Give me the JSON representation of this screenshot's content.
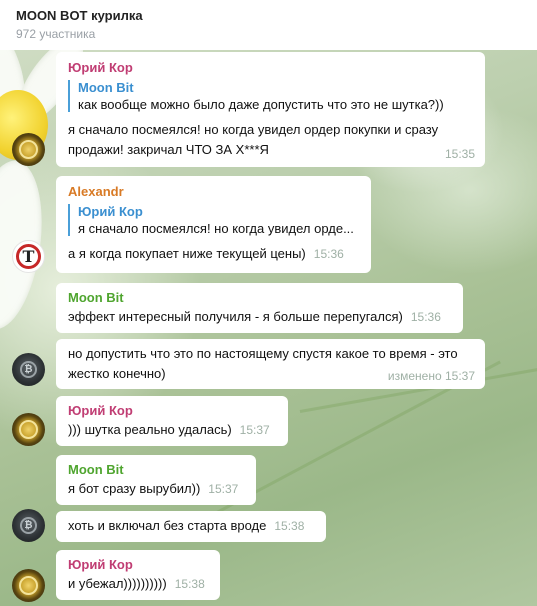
{
  "chat": {
    "title": "MOON BOT курилка",
    "members": "972 участника"
  },
  "messages": [
    {
      "sender": "Юрий Кор",
      "reply": {
        "name": "Moon Bit",
        "text": "как вообще можно было даже допустить что это не шутка?))"
      },
      "text": "я сначало посмеялся! но когда увидел ордер покупки и сразу продажи! закричал ЧТО ЗА Х***Я",
      "time": "15:35"
    },
    {
      "sender": "Alexandr",
      "reply": {
        "name": "Юрий Кор",
        "text": "я сначало посмеялся! но когда увидел орде..."
      },
      "text": "а я когда покупает ниже текущей цены)",
      "time": "15:36"
    },
    {
      "sender": "Moon Bit",
      "text": "эффект интересный получиля - я больше перепугался)",
      "time": "15:36"
    },
    {
      "text": "но допустить что это по настоящему спустя какое то время - это жестко конечно)",
      "time": "изменено 15:37"
    },
    {
      "sender": "Юрий Кор",
      "text": "))) шутка реально удалась)",
      "time": "15:37"
    },
    {
      "sender": "Moon Bit",
      "text": "я бот сразу вырубил))",
      "time": "15:37"
    },
    {
      "text": "хоть и включал без старта вроде",
      "time": "15:38"
    },
    {
      "sender": "Юрий Кор",
      "text": "и убежал))))))))))",
      "time": "15:38"
    }
  ],
  "avatars": {
    "yuri": "gold-coin-avatar",
    "alexandr": "tf-logo-avatar",
    "moonbit": "bitcoin-avatar"
  },
  "colors": {
    "yuri": "#c03d73",
    "alexandr": "#d87a25",
    "moonbit": "#4fa52f",
    "reply_bar": "#4a9fd8"
  }
}
